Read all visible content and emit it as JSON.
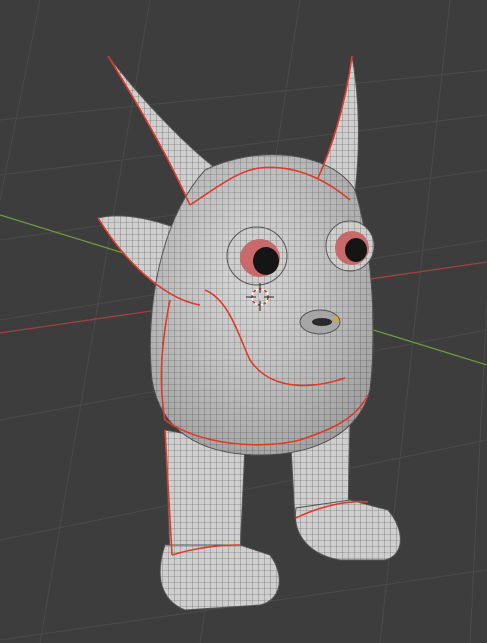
{
  "viewport": {
    "mode": "edit-mode",
    "overlay": "wireframe-seams",
    "colors": {
      "background": "#3d3d3d",
      "grid": "#4a4a4a",
      "x_axis": "#a04040",
      "y_axis": "#6e9a3a",
      "mesh_fill": "#cfcfcf",
      "mesh_wire": "#555555",
      "seam": "#e03a2a",
      "eye_iris": "#c86a6a",
      "pupil": "#151515",
      "cursor": "#c83232"
    }
  },
  "model": {
    "name": "monster-creature",
    "parts": [
      "left-horn",
      "right-horn",
      "left-ear",
      "body",
      "left-eye",
      "right-eye",
      "mouth",
      "left-leg",
      "right-leg",
      "left-foot",
      "right-foot"
    ]
  },
  "cursor": {
    "type": "3d-cursor"
  },
  "origin": {
    "type": "object-origin"
  }
}
